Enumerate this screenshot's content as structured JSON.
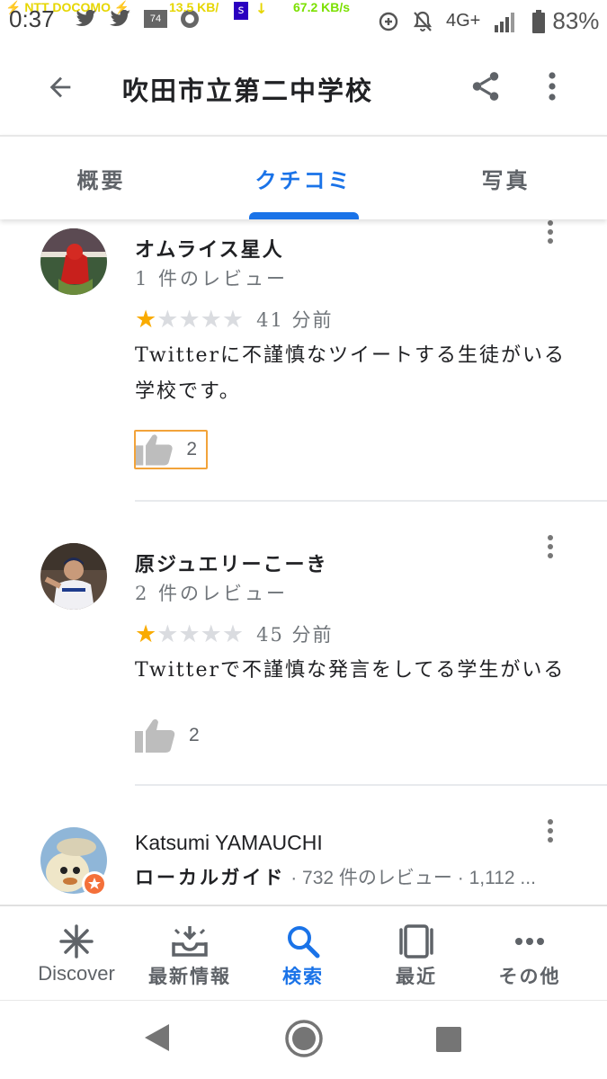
{
  "status_bar": {
    "time": "0:37",
    "carrier": "⚡ NTT DOCOMO ⚡",
    "speed_up": "13.5 KB/",
    "speed_down": "67.2 KB/s",
    "badge_s": "s",
    "notif_count": "74",
    "network": "4G+",
    "battery": "83%"
  },
  "app_bar": {
    "title": "吹田市立第二中学校"
  },
  "tabs": [
    {
      "label": "概要"
    },
    {
      "label": "クチコミ"
    },
    {
      "label": "写真"
    }
  ],
  "reviews": [
    {
      "author": "オムライス星人",
      "meta": "1 件のレビュー",
      "rating": 1,
      "time": "41 分前",
      "text_line1": "Twitterに不謹慎なツイートする生徒がいる",
      "text_line2": "学校です。",
      "likes": "2"
    },
    {
      "author": "原ジュエリーこーき",
      "meta": "2 件のレビュー",
      "rating": 1,
      "time": "45 分前",
      "text_line1": "Twitterで不謹慎な発言をしてる学生がいる",
      "likes": "2"
    },
    {
      "author": "Katsumi YAMAUCHI",
      "meta_prefix": "ローカルガイド",
      "meta_rest": " · 732 件のレビュー · 1,112 ..."
    }
  ],
  "bottom_nav": [
    {
      "label": "Discover",
      "icon": "asterisk-icon"
    },
    {
      "label": "最新情報",
      "icon": "inbox-icon"
    },
    {
      "label": "検索",
      "icon": "search-icon"
    },
    {
      "label": "最近",
      "icon": "recent-cards-icon"
    },
    {
      "label": "その他",
      "icon": "more-horiz-icon"
    }
  ],
  "colors": {
    "accent": "#1a73e8",
    "star_filled": "#f9ab00",
    "star_empty": "#dadce0",
    "focus_outline": "#f2a33a"
  }
}
